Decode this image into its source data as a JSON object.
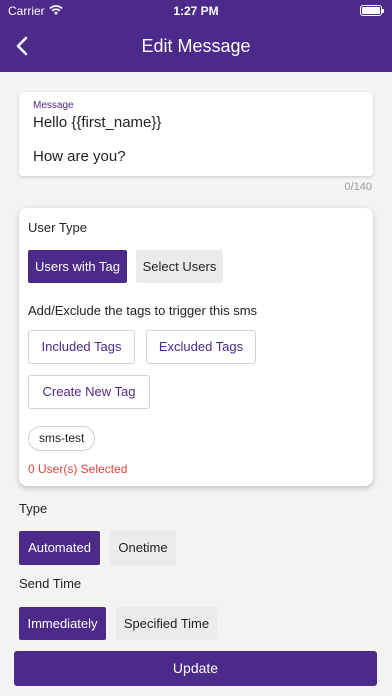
{
  "status_bar": {
    "carrier": "Carrier",
    "time": "1:27 PM"
  },
  "header": {
    "title": "Edit Message",
    "back_icon": "chevron-left-icon"
  },
  "message": {
    "label": "Message",
    "value": "Hello {{first_name}}\n\nHow are you?",
    "counter": "0/140"
  },
  "user_type": {
    "title": "User Type",
    "options": [
      "Users with Tag",
      "Select Users"
    ],
    "selected": "Users with Tag",
    "description": "Add/Exclude the tags to trigger this sms",
    "included_tags_label": "Included Tags",
    "excluded_tags_label": "Excluded Tags",
    "create_tag_label": "Create New Tag",
    "tags": [
      "sms-test"
    ],
    "selected_count": "0 User(s) Selected"
  },
  "type": {
    "label": "Type",
    "options": [
      "Automated",
      "Onetime"
    ],
    "selected": "Automated"
  },
  "send_time": {
    "label": "Send Time",
    "options": [
      "Immediately",
      "Specified Time"
    ],
    "selected": "Immediately"
  },
  "update_label": "Update",
  "colors": {
    "primary": "#4b2a8a",
    "warning": "#e0443a",
    "secondary_bg": "#ebebeb"
  }
}
